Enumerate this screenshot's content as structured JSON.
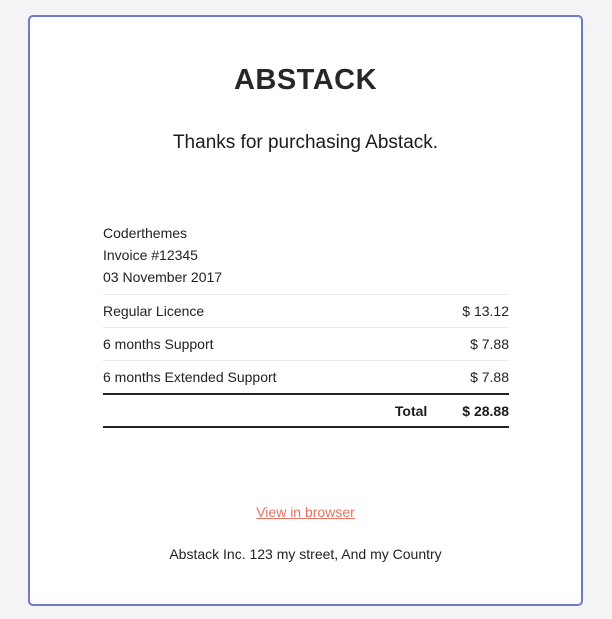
{
  "brand": {
    "logo_text": "ABSTACK"
  },
  "message": {
    "thanks": "Thanks for purchasing Abstack."
  },
  "invoice": {
    "company": "Coderthemes",
    "number": "Invoice #12345",
    "date": "03 November 2017",
    "items": [
      {
        "description": "Regular Licence",
        "amount": "$ 13.12"
      },
      {
        "description": "6 months Support",
        "amount": "$ 7.88"
      },
      {
        "description": "6 months Extended Support",
        "amount": "$ 7.88"
      }
    ],
    "total_label": "Total",
    "total_amount": "$ 28.88"
  },
  "footer": {
    "view_in_browser": "View in browser",
    "address": "Abstack Inc. 123 my street, And my Country"
  },
  "colors": {
    "card_border": "#6f79c7",
    "link": "#e6735f",
    "background": "#f4f4f6"
  }
}
